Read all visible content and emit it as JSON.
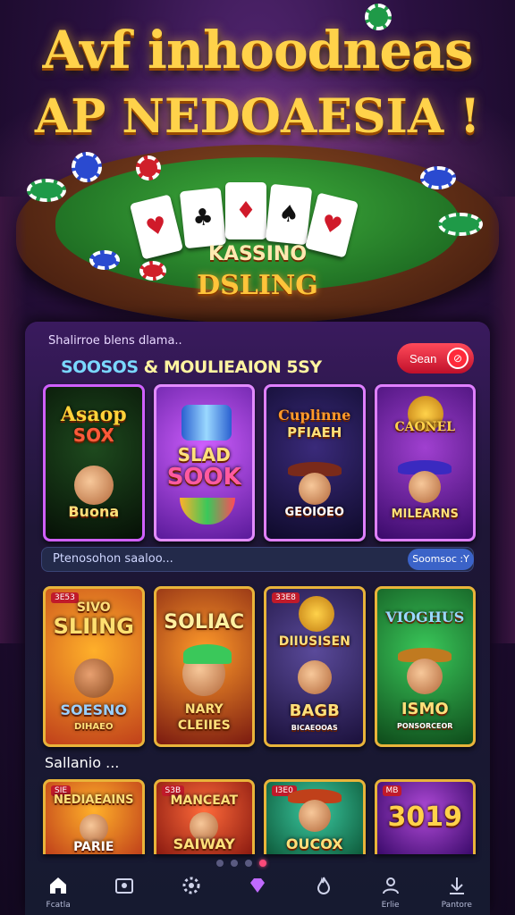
{
  "hero": {
    "title_line1": "Avf inhoodneas",
    "title_line2": "AP NEDOAESIA !",
    "table_label": "KASSINO",
    "table_sign": "DSLING"
  },
  "panel": {
    "subtitle": "Shalirroe blens dlama..",
    "promo_title_a": "SOOSOS",
    "promo_title_amp": "&",
    "promo_title_b": "MOULIEAION 5SY",
    "sign_button": "Sean"
  },
  "featured_games": [
    {
      "line1": "Asaop",
      "line2": "SOX",
      "line3": "Buona"
    },
    {
      "line1": "SLAD",
      "line2": "SOOK",
      "line3": ""
    },
    {
      "line1": "Cuplinne",
      "line2": "PFIAEH",
      "line3": "GEOIOEO"
    },
    {
      "line1": "CAONEL",
      "line2": "",
      "line3": "MILEARNS"
    }
  ],
  "search": {
    "placeholder": "Ptenosohon saaloo...",
    "filter_button": "Soomsoc :Y"
  },
  "popular_games": [
    {
      "badge": "3E53",
      "line1": "SIVO",
      "line2": "SLIING",
      "line3": "SOESNO",
      "line4": "DIHAEO"
    },
    {
      "badge": "",
      "line1": "SOLIAC",
      "line2": "",
      "line3": "NARY",
      "line4": "CLEIIES"
    },
    {
      "badge": "33E8",
      "line1": "DIIUSISEN",
      "line2": "",
      "line3": "BAGB",
      "line4": "BICAEOOAS"
    },
    {
      "badge": "",
      "line1": "VIOGHUS",
      "line2": "",
      "line3": "ISMO",
      "line4": "PONSORCEOR"
    }
  ],
  "section": {
    "label": "Sallanio ..."
  },
  "more_games": [
    {
      "badge": "SIE",
      "line1": "NEDIAEAINS",
      "line2": "PARIE"
    },
    {
      "badge": "S3B",
      "line1": "MANCEAT",
      "line2": "SAIWAY"
    },
    {
      "badge": "I3E0",
      "line1": "",
      "line2": "OUCOX"
    },
    {
      "badge": "MB",
      "line1": "3019",
      "line2": ""
    }
  ],
  "nav": [
    {
      "label": "Fcatla",
      "icon": "home-icon"
    },
    {
      "label": "",
      "icon": "lobby-icon"
    },
    {
      "label": "",
      "icon": "settings-icon"
    },
    {
      "label": "",
      "icon": "diamond-icon"
    },
    {
      "label": "",
      "icon": "fire-icon"
    },
    {
      "label": "Erlie",
      "icon": "user-icon"
    },
    {
      "label": "Pantore",
      "icon": "gift-icon"
    }
  ],
  "colors": {
    "accent": "#ffd24a",
    "panel": "#1e1636",
    "sign": "#e01a35",
    "filter": "#3b63c8"
  }
}
